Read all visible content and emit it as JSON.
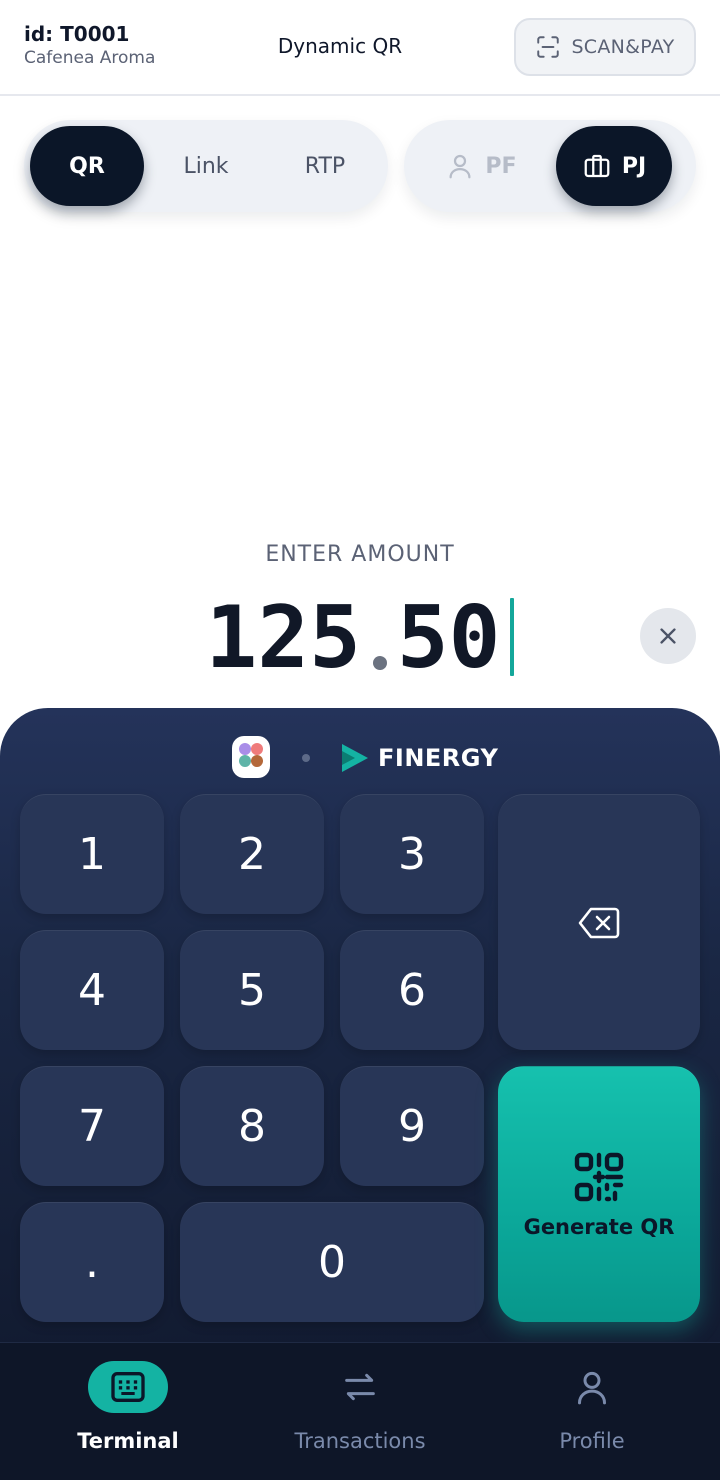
{
  "header": {
    "terminal_id": "id: T0001",
    "merchant_name": "Cafenea Aroma",
    "title": "Dynamic QR",
    "scan_pay_label": "SCAN&PAY"
  },
  "payment_method_tabs": [
    {
      "label": "QR",
      "active": true
    },
    {
      "label": "Link",
      "active": false
    },
    {
      "label": "RTP",
      "active": false
    }
  ],
  "client_type_tabs": [
    {
      "label": "PF",
      "icon": "person-icon",
      "active": false
    },
    {
      "label": "PJ",
      "icon": "briefcase-icon",
      "active": true
    }
  ],
  "amount": {
    "label": "ENTER AMOUNT",
    "integer_part": "125",
    "decimal_part": "50"
  },
  "brand": {
    "name": "FINERGY"
  },
  "keypad": {
    "keys": [
      "1",
      "2",
      "3",
      "4",
      "5",
      "6",
      "7",
      "8",
      "9",
      ".",
      "0"
    ],
    "generate_label": "Generate QR"
  },
  "bottom_nav": [
    {
      "label": "Terminal",
      "icon": "keyboard-icon",
      "active": true
    },
    {
      "label": "Transactions",
      "icon": "arrows-swap-icon",
      "active": false
    },
    {
      "label": "Profile",
      "icon": "user-icon",
      "active": false
    }
  ],
  "colors": {
    "accent": "#14b3a3",
    "dark": "#0b1628",
    "panel": "#1a2744"
  }
}
